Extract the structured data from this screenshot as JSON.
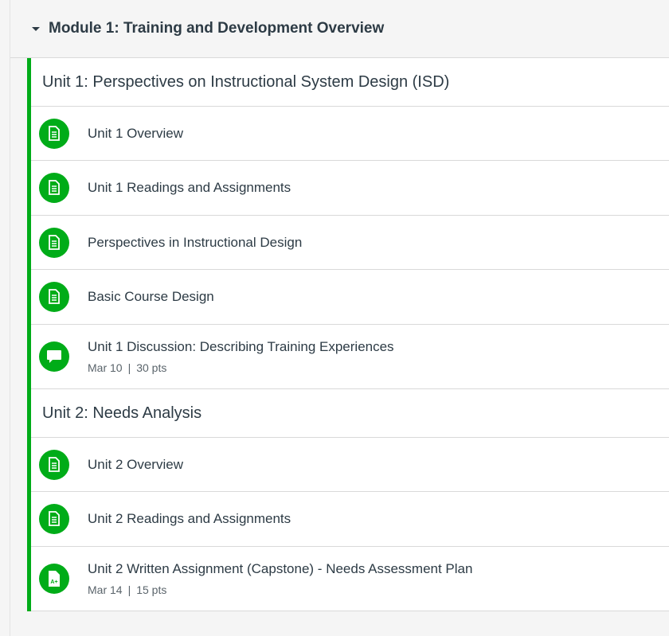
{
  "module": {
    "title": "Module 1: Training and Development Overview",
    "accent_color": "#00ac18"
  },
  "rows": [
    {
      "kind": "subheader",
      "title": "Unit 1: Perspectives on Instructional System Design (ISD)"
    },
    {
      "kind": "item",
      "icon": "page-icon",
      "title": "Unit 1 Overview"
    },
    {
      "kind": "item",
      "icon": "page-icon",
      "title": "Unit 1 Readings and Assignments"
    },
    {
      "kind": "item",
      "icon": "page-icon",
      "title": "Perspectives in Instructional Design"
    },
    {
      "kind": "item",
      "icon": "page-icon",
      "title": "Basic Course Design"
    },
    {
      "kind": "item",
      "icon": "discussion-icon",
      "title": "Unit 1 Discussion: Describing Training Experiences",
      "due": "Mar 10",
      "points": "30 pts"
    },
    {
      "kind": "subheader",
      "title": "Unit 2: Needs Analysis"
    },
    {
      "kind": "item",
      "icon": "page-icon",
      "title": "Unit 2 Overview"
    },
    {
      "kind": "item",
      "icon": "page-icon",
      "title": "Unit 2 Readings and Assignments"
    },
    {
      "kind": "item",
      "icon": "assignment-icon",
      "title": "Unit 2 Written Assignment (Capstone) - Needs Assessment Plan",
      "due": "Mar 14",
      "points": "15 pts"
    }
  ]
}
